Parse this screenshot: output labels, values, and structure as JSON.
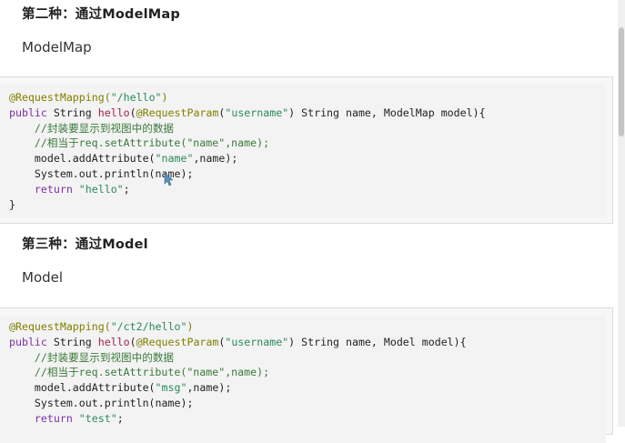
{
  "section1": {
    "heading": "第二种：通过ModelMap",
    "subtitle": "ModelMap",
    "code": [
      [
        {
          "t": "ann",
          "v": "@RequestMapping("
        },
        {
          "t": "str",
          "v": "\"/hello\""
        },
        {
          "t": "ann",
          "v": ")"
        }
      ],
      [
        {
          "t": "kw",
          "v": "public"
        },
        {
          "t": "pln",
          "v": " String "
        },
        {
          "t": "fn",
          "v": "hello"
        },
        {
          "t": "pln",
          "v": "("
        },
        {
          "t": "ann",
          "v": "@RequestParam"
        },
        {
          "t": "pln",
          "v": "("
        },
        {
          "t": "str",
          "v": "\"username\""
        },
        {
          "t": "pln",
          "v": ") String name, ModelMap model){"
        }
      ],
      [
        {
          "t": "cmt",
          "v": "    //封装要显示到视图中的数据"
        }
      ],
      [
        {
          "t": "cmt",
          "v": "    //相当于req.setAttribute(\"name\",name);"
        }
      ],
      [
        {
          "t": "pln",
          "v": "    model.addAttribute("
        },
        {
          "t": "str",
          "v": "\"name\""
        },
        {
          "t": "pln",
          "v": ",name);"
        }
      ],
      [
        {
          "t": "pln",
          "v": "    System.out.println(name);"
        }
      ],
      [
        {
          "t": "kw",
          "v": "    return"
        },
        {
          "t": "pln",
          "v": " "
        },
        {
          "t": "str",
          "v": "\"hello\""
        },
        {
          "t": "pln",
          "v": ";"
        }
      ],
      [
        {
          "t": "pln",
          "v": "}"
        }
      ]
    ]
  },
  "section2": {
    "heading": "第三种：通过Model",
    "subtitle": "Model",
    "code": [
      [
        {
          "t": "ann",
          "v": "@RequestMapping("
        },
        {
          "t": "str",
          "v": "\"/ct2/hello\""
        },
        {
          "t": "ann",
          "v": ")"
        }
      ],
      [
        {
          "t": "kw",
          "v": "public"
        },
        {
          "t": "pln",
          "v": " String "
        },
        {
          "t": "fn",
          "v": "hello"
        },
        {
          "t": "pln",
          "v": "("
        },
        {
          "t": "ann",
          "v": "@RequestParam"
        },
        {
          "t": "pln",
          "v": "("
        },
        {
          "t": "str",
          "v": "\"username\""
        },
        {
          "t": "pln",
          "v": ") String name, Model model){"
        }
      ],
      [
        {
          "t": "cmt",
          "v": "    //封装要显示到视图中的数据"
        }
      ],
      [
        {
          "t": "cmt",
          "v": "    //相当于req.setAttribute(\"name\",name);"
        }
      ],
      [
        {
          "t": "pln",
          "v": "    model.addAttribute("
        },
        {
          "t": "str",
          "v": "\"msg\""
        },
        {
          "t": "pln",
          "v": ",name);"
        }
      ],
      [
        {
          "t": "pln",
          "v": "    System.out.println(name);"
        }
      ],
      [
        {
          "t": "kw",
          "v": "    return"
        },
        {
          "t": "pln",
          "v": " "
        },
        {
          "t": "str",
          "v": "\"test\""
        },
        {
          "t": "pln",
          "v": ";"
        }
      ]
    ]
  },
  "colors": {
    "annotation": "#808000",
    "string": "#2a8a5a",
    "keyword": "#7b2fa8",
    "method": "#a02050",
    "comment": "#3a7a3a"
  },
  "icons": {
    "cursor": "mouse-pointer-icon"
  }
}
